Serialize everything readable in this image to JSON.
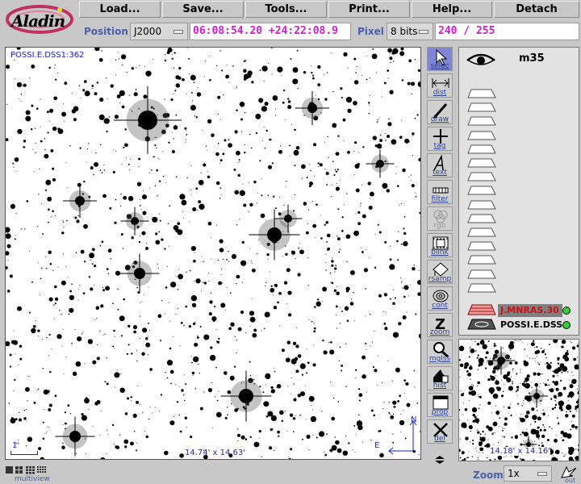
{
  "app": {
    "logo_text": "Aladin"
  },
  "menu": {
    "load": "Load...",
    "save": "Save...",
    "tools": "Tools...",
    "print": "Print...",
    "help": "Help...",
    "detach": "Detach"
  },
  "position_bar": {
    "position_label": "Position",
    "frame_value": "J2000",
    "coordinates": "06:08:54.20 +24:22:08.9",
    "pixel_label": "Pixel",
    "pixel_mode": "8 bits",
    "pixel_value": "240 / 255"
  },
  "view": {
    "plane_label": "POSSI.E.DSS1:362",
    "scale_label": "1'",
    "fov_label": "14.74' x 14.63'",
    "compass_north": "N",
    "compass_east": "E"
  },
  "tools": [
    {
      "label": "selec",
      "icon": "cursor-arrow-icon"
    },
    {
      "label": "dist",
      "icon": "double-arrow-icon"
    },
    {
      "label": "draw",
      "icon": "pencil-icon"
    },
    {
      "label": "tag",
      "icon": "crosshair-icon"
    },
    {
      "label": "text",
      "icon": "text-a-icon"
    },
    {
      "label": "filter",
      "icon": "filter-icon"
    },
    {
      "label": "rgb",
      "icon": "rgb-circles-icon"
    },
    {
      "label": "blink",
      "icon": "film-icon"
    },
    {
      "label": "rsamp",
      "icon": "resample-icon"
    },
    {
      "label": "cont",
      "icon": "contour-icon"
    },
    {
      "label": "zoom",
      "icon": "z-icon"
    },
    {
      "label": "mglss",
      "icon": "magnifier-icon"
    },
    {
      "label": "hist",
      "icon": "histogram-icon"
    },
    {
      "label": "prop",
      "icon": "properties-icon"
    },
    {
      "label": "del",
      "icon": "delete-x-icon"
    }
  ],
  "stack": {
    "target": "m35",
    "planes": [
      {
        "name": "J.MNRAS.30",
        "color": "#d01010"
      },
      {
        "name": "POSSI.E.DSS",
        "color": "#000000"
      }
    ]
  },
  "thumbnail": {
    "fov_label": "14.18' x 14.16'"
  },
  "bottom": {
    "multiview_label": "multiview",
    "zoom_label": "Zoom",
    "zoom_value": "1x",
    "out_label": "out"
  },
  "colors": {
    "accent": "#4a5fa8",
    "coords": "#d21bd2",
    "active_tool": "#7f86d6"
  }
}
